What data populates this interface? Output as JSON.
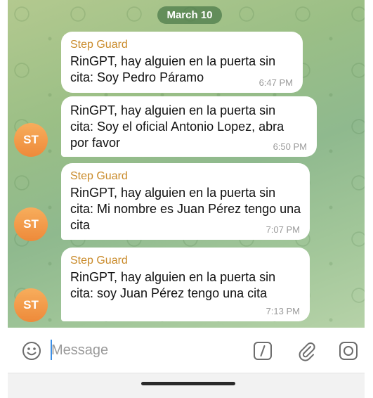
{
  "date_separator": "March 10",
  "messages": [
    {
      "sender": "Step Guard",
      "text": "RinGPT, hay alguien en la puerta sin cita: Soy Pedro Páramo",
      "time": "6:47 PM",
      "avatar": ""
    },
    {
      "sender": "",
      "text": "RinGPT, hay alguien en la puerta sin cita: Soy el oficial Antonio Lopez, abra por favor",
      "time": "6:50 PM",
      "avatar": "ST"
    },
    {
      "sender": "Step Guard",
      "text": "RinGPT, hay alguien en la puerta sin cita: Mi nombre es Juan Pérez tengo una cita",
      "time": "7:07 PM",
      "avatar": "ST"
    },
    {
      "sender": "Step Guard",
      "text": "RinGPT, hay alguien en la puerta sin cita: soy Juan Pérez tengo una cita",
      "time": "7:13 PM",
      "avatar": "ST"
    }
  ],
  "input": {
    "placeholder": "Message"
  },
  "icons": {
    "emoji": "emoji-icon",
    "command": "slash-command-icon",
    "attach": "paperclip-icon",
    "camera": "camera-icon"
  },
  "colors": {
    "sender": "#c98a29",
    "avatar": "#f0923f",
    "date_pill": "#4a7848"
  }
}
